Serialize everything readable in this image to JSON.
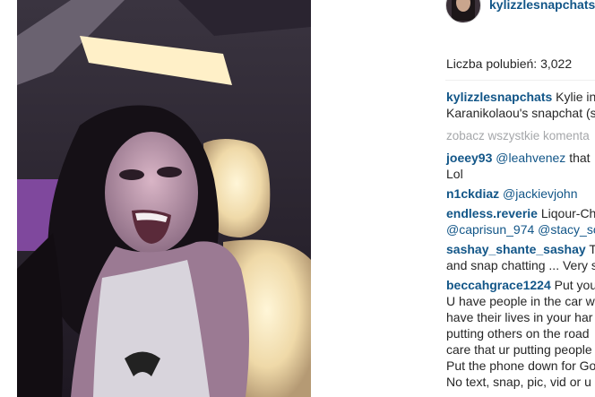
{
  "post": {
    "author": "kylizzlesnapchats",
    "likes_label": "Liczba polubień: 3,022"
  },
  "caption": {
    "user": "kylizzlesnapchats",
    "line1": "Kylie in",
    "line2": "Karanikolaou's snapchat (s"
  },
  "view_all_label": "zobacz wszystkie komenta",
  "comments": [
    {
      "user": "joeey93",
      "mention": "@leahvenez",
      "text1": " that",
      "line2": "Lol"
    },
    {
      "user": "n1ckdiaz",
      "mention": "@jackievjohn"
    },
    {
      "user": "endless.reverie",
      "text1": "Liqour-Ch",
      "line2a": "@caprisun_974",
      "line2b": "@stacy_sc"
    },
    {
      "user": "sashay_shante_sashay",
      "text1": "Te",
      "line2": "and snap chatting ... Very s"
    },
    {
      "user": "beccahgrace1224",
      "text1": "Put you",
      "lines": [
        "U have people in the car w",
        "have their lives in your har",
        "putting others on the road",
        "care that ur putting people",
        "Put the phone down for Go",
        "No text, snap, pic, vid or u"
      ]
    }
  ],
  "colors": {
    "link": "#125688",
    "text": "#262626",
    "muted": "#a5a7aa"
  }
}
